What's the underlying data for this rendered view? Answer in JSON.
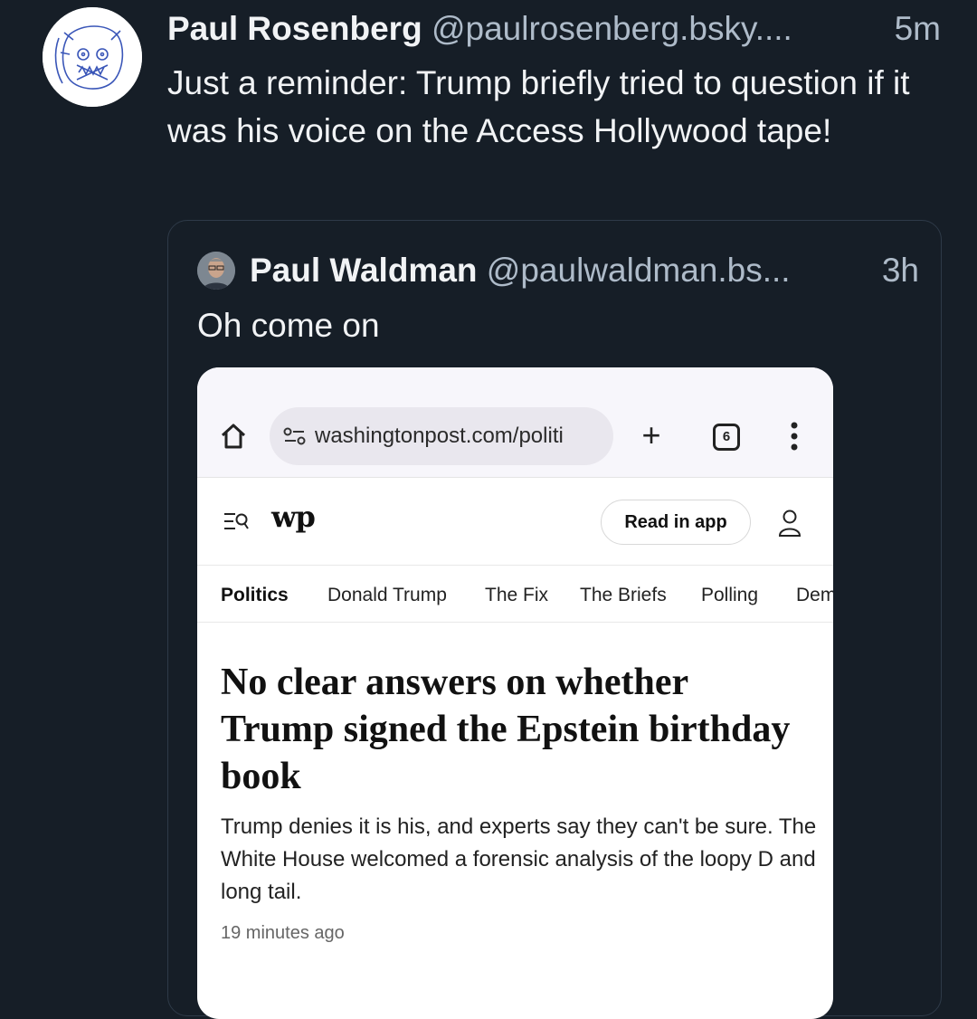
{
  "post": {
    "author_name": "Paul Rosenberg",
    "author_handle": "@paulrosenberg.bsky....",
    "time_ago": "5m",
    "text": "Just a reminder: Trump briefly tried to question if it was his voice on the Access Hollywood tape!"
  },
  "quote": {
    "author_name": "Paul Waldman",
    "author_handle": "@paulwaldman.bs...",
    "time_ago": "3h",
    "text": "Oh come on"
  },
  "screenshot": {
    "browser": {
      "url": "washingtonpost.com/politi",
      "tab_count": "6"
    },
    "site": {
      "logo": "wp",
      "read_in_app": "Read in app"
    },
    "nav": [
      "Politics",
      "Donald Trump",
      "The Fix",
      "The Briefs",
      "Polling",
      "Dem"
    ],
    "article": {
      "headline": "No clear answers on whether Trump signed the Epstein birthday book",
      "dek": "Trump denies it is his, and experts say they can't be sure. The White House welcomed a forensic analysis of the loopy D and long tail.",
      "timestamp": "19 minutes ago"
    }
  },
  "colors": {
    "background": "#161e27",
    "text_primary": "#f1f3f5",
    "text_secondary": "#aebbc9",
    "card_border": "#2e3a48"
  },
  "icons": [
    "home-icon",
    "site-settings-icon",
    "plus-icon",
    "tabs-icon",
    "more-vertical-icon",
    "menu-search-icon",
    "account-icon"
  ]
}
